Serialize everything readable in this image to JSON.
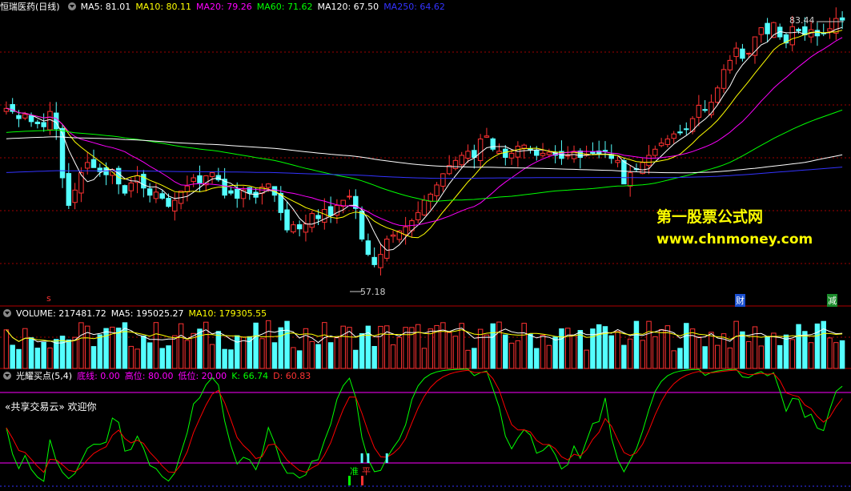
{
  "header": {
    "stock_name": "恒瑞医药(日线)",
    "ma_labels": [
      {
        "text": "MA5: 81.01",
        "color": "#ffffff"
      },
      {
        "text": "MA10: 80.11",
        "color": "#ffff00"
      },
      {
        "text": "MA20: 79.26",
        "color": "#ff00ff"
      },
      {
        "text": "MA60: 71.62",
        "color": "#00ff00"
      },
      {
        "text": "MA120: 67.50",
        "color": "#ffffff"
      },
      {
        "text": "MA250: 64.62",
        "color": "#3333ff"
      }
    ]
  },
  "volume_header": {
    "labels": [
      {
        "text": "VOLUME: 217481.72",
        "color": "#ffffff"
      },
      {
        "text": "MA5: 195025.27",
        "color": "#ffffff"
      },
      {
        "text": "MA10: 179305.55",
        "color": "#ffff00"
      }
    ]
  },
  "indicator_header": {
    "labels": [
      {
        "text": "光耀买点(5,4)",
        "color": "#ffffff"
      },
      {
        "text": "底线: 0.00",
        "color": "#ff00ff"
      },
      {
        "text": "高位: 80.00",
        "color": "#ff00ff"
      },
      {
        "text": "低位: 20.00",
        "color": "#ff00ff"
      },
      {
        "text": "K: 66.74",
        "color": "#00ff00"
      },
      {
        "text": "D: 60.83",
        "color": "#ff3333"
      }
    ]
  },
  "annotations": {
    "high_label": "83.44",
    "low_label": "57.18",
    "watermark_line1": "第一股票公式网",
    "watermark_line2": "www.chnmoney.com",
    "banner": "«共享交易云» 欢迎你",
    "marker_cai": "财",
    "marker_jian": "减",
    "marker_zhun": "准",
    "marker_ping": "平",
    "marker_left": "s"
  },
  "colors": {
    "up": "#ff3232",
    "down": "#54ffff",
    "ma5": "#ffffff",
    "ma10": "#ffff00",
    "ma20": "#ff00ff",
    "ma60": "#00ff00",
    "ma120": "#ffffff",
    "ma250": "#3333ff",
    "grid": "#a00000",
    "k_line": "#00ff00",
    "d_line": "#ff0000"
  },
  "chart_data": [
    {
      "type": "candlestick",
      "title": "恒瑞医药(日线)",
      "price_range": [
        56,
        84
      ],
      "series": [
        {
          "name": "MA5",
          "last": 81.01
        },
        {
          "name": "MA10",
          "last": 80.11
        },
        {
          "name": "MA20",
          "last": 79.26
        },
        {
          "name": "MA60",
          "last": 71.62
        },
        {
          "name": "MA120",
          "last": 67.5
        },
        {
          "name": "MA250",
          "last": 64.62
        }
      ],
      "annotations": [
        {
          "text": "83.44",
          "kind": "high"
        },
        {
          "text": "57.18",
          "kind": "low"
        }
      ],
      "closes": [
        74.8,
        74.5,
        73.8,
        74.2,
        73.5,
        73.3,
        73.0,
        74.5,
        72.8,
        68.0,
        65.3,
        66.8,
        68.5,
        69.5,
        69.0,
        68.6,
        68.3,
        68.8,
        67.4,
        66.5,
        67.5,
        68.2,
        67.0,
        66.3,
        66.6,
        66.0,
        65.2,
        65.8,
        66.7,
        67.2,
        68.0,
        67.5,
        68.2,
        68.5,
        67.8,
        66.3,
        66.5,
        66.0,
        66.8,
        66.5,
        66.1,
        67.1,
        67.4,
        66.3,
        64.6,
        62.9,
        63.4,
        63.0,
        63.5,
        64.5,
        64.0,
        64.9,
        64.3,
        65.3,
        65.8,
        66.2,
        65.0,
        62.0,
        60.5,
        59.5,
        60.5,
        62.0,
        62.4,
        62.8,
        63.2,
        63.8,
        64.6,
        65.8,
        66.4,
        67.3,
        68.4,
        69.2,
        69.7,
        70.2,
        70.6,
        70.0,
        71.8,
        72.1,
        70.8,
        70.6,
        70.0,
        70.4,
        71.1,
        71.2,
        70.8,
        70.2,
        70.4,
        70.5,
        70.2,
        69.9,
        70.2,
        70.6,
        70.0,
        70.3,
        70.4,
        70.3,
        70.6,
        69.9,
        69.7,
        67.4,
        68.5,
        68.8,
        69.5,
        70.2,
        70.8,
        71.4,
        71.8,
        72.3,
        72.4,
        72.8,
        73.8,
        75.1,
        74.6,
        75.4,
        76.8,
        78.6,
        79.5,
        80.7,
        79.7,
        80.2,
        81.8,
        82.7,
        82.1,
        83.2,
        81.8,
        81.2,
        82.8,
        82.4,
        82.0,
        82.5,
        81.9,
        82.1,
        82.6,
        83.6,
        83.44
      ]
    },
    {
      "type": "bar",
      "title": "VOLUME",
      "series": [
        {
          "name": "VOLUME",
          "last": 217481.72
        },
        {
          "name": "MA5",
          "last": 195025.27
        },
        {
          "name": "MA10",
          "last": 179305.55
        }
      ]
    },
    {
      "type": "line",
      "title": "光耀买点(5,4)",
      "series": [
        {
          "name": "底线",
          "last": 0.0
        },
        {
          "name": "高位",
          "last": 80.0
        },
        {
          "name": "低位",
          "last": 20.0
        },
        {
          "name": "K",
          "last": 66.74
        },
        {
          "name": "D",
          "last": 60.83
        }
      ]
    }
  ]
}
